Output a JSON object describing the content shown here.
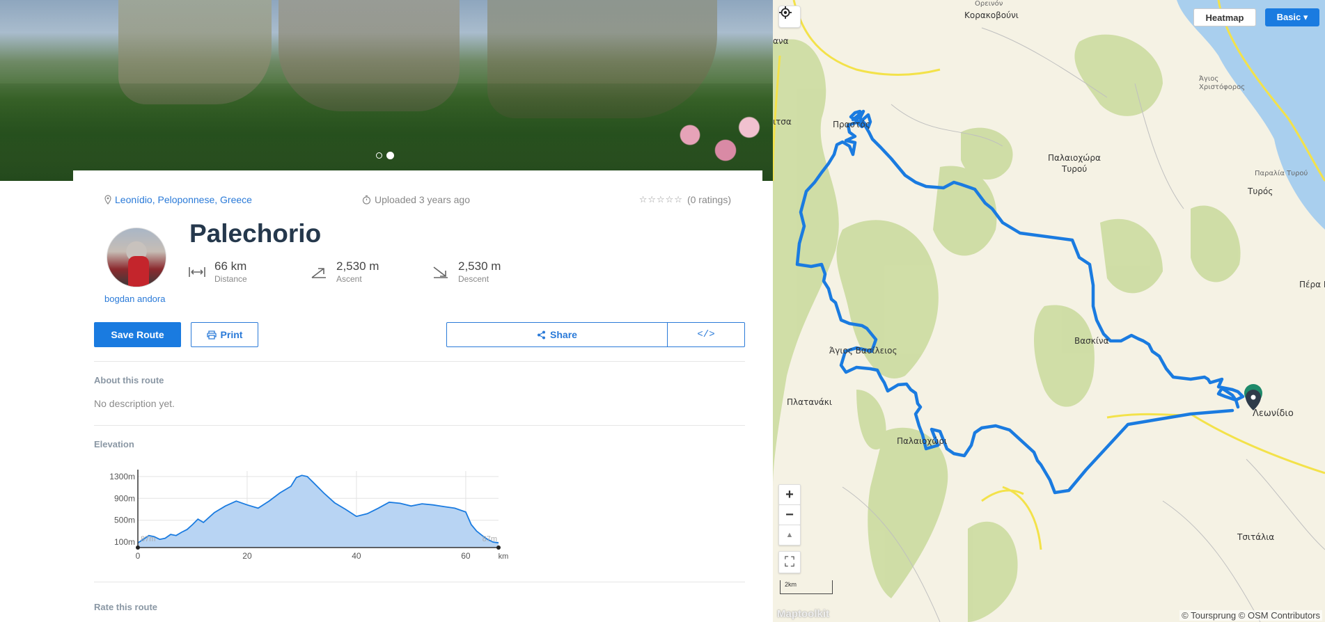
{
  "route": {
    "location": "Leonídio, Peloponnese, Greece",
    "uploaded": "Uploaded 3 years ago",
    "rating_text": "(0 ratings)",
    "rating_stars": "☆☆☆☆☆",
    "title": "Palechorio",
    "author": "bogdan andora",
    "stats": {
      "distance": {
        "value": "66 km",
        "label": "Distance"
      },
      "ascent": {
        "value": "2,530 m",
        "label": "Ascent"
      },
      "descent": {
        "value": "2,530 m",
        "label": "Descent"
      }
    }
  },
  "actions": {
    "save": "Save Route",
    "print": "Print",
    "share": "Share",
    "embed": "</>"
  },
  "about": {
    "title": "About this route",
    "text": "No description yet."
  },
  "elevation": {
    "title": "Elevation",
    "start_label": "87m",
    "end_label": "87m"
  },
  "rate": {
    "title": "Rate this route"
  },
  "chart_data": {
    "type": "area",
    "title": "",
    "xlabel": "km",
    "ylabel": "",
    "x_ticks": [
      0,
      20,
      40,
      60
    ],
    "y_ticks": [
      "100m",
      "500m",
      "900m",
      "1300m"
    ],
    "xlim": [
      0,
      66
    ],
    "ylim": [
      0,
      1400
    ],
    "x": [
      0,
      1,
      2,
      3,
      4,
      5,
      6,
      7,
      8,
      9,
      10,
      11,
      12,
      13,
      14,
      16,
      18,
      20,
      22,
      24,
      26,
      28,
      29,
      30,
      31,
      32,
      34,
      36,
      38,
      40,
      42,
      44,
      46,
      48,
      50,
      52,
      54,
      56,
      58,
      60,
      61,
      62,
      63,
      64,
      65,
      66
    ],
    "y": [
      87,
      150,
      220,
      200,
      150,
      170,
      240,
      220,
      280,
      330,
      420,
      520,
      460,
      550,
      640,
      760,
      850,
      780,
      720,
      850,
      1000,
      1120,
      1280,
      1320,
      1300,
      1200,
      1000,
      820,
      700,
      570,
      620,
      720,
      830,
      810,
      760,
      800,
      780,
      750,
      720,
      650,
      420,
      300,
      220,
      150,
      100,
      87
    ]
  },
  "map": {
    "heatmap": "Heatmap",
    "basic": "Basic ▾",
    "zoom_in": "+",
    "zoom_out": "−",
    "compass": "▲",
    "fullscreen": "⛶",
    "scale": "2km",
    "attribution": "© Toursprung © OSM Contributors",
    "maptiler": "Maptoolkit",
    "places": {
      "oreinon": "Ορεινόν",
      "korakovouni": "Κορακοβούνι",
      "prastos": "Πραστός",
      "palaiochora": "Παλαιοχώρα",
      "tyrou": "Τυρού",
      "agios_christoforos_1": "Άγιος",
      "agios_christoforos_2": "Χριστόφορος",
      "paralia_tyrou": "Παραλία Τυρού",
      "tyros": "Τυρός",
      "vaskina": "Βασκίνα",
      "agios_vasileios": "Άγιος Βασίλειος",
      "platanaki": "Πλατανάκι",
      "palaiochori": "Παλαιοχώρι",
      "leonidio": "Λεωνίδιο",
      "pera_meli": "Πέρα Μ",
      "tsitalia": "Τσιτάλια",
      "left_tsa": "ιτσα",
      "left_na": "ανα"
    }
  }
}
